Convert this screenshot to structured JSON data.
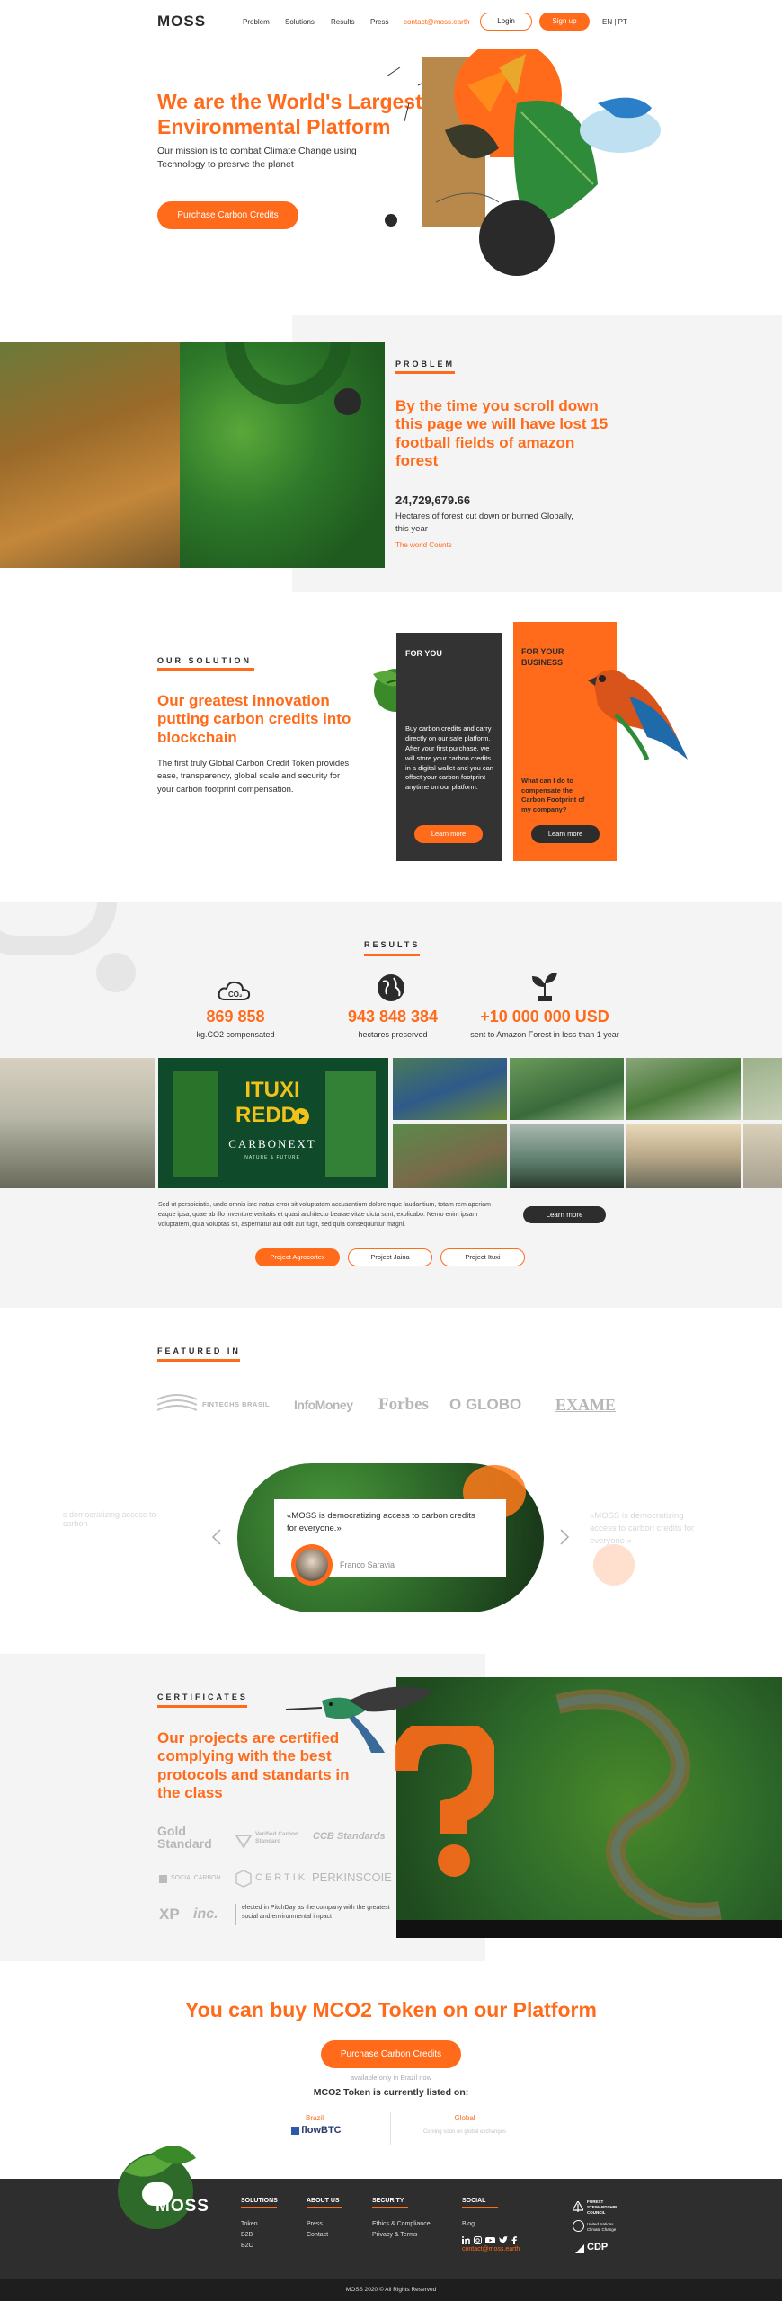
{
  "nav": {
    "logo": "MOSS",
    "links": [
      "Problem",
      "Solutions",
      "Results",
      "Press"
    ],
    "contact": "contact@moss.earth",
    "login": "Login",
    "signup": "Sign up",
    "lang": "EN | PT"
  },
  "hero": {
    "title": "We are the World's Largest Environmental Platform",
    "subtitle": "Our mission is to combat Climate Change using Technology to presrve the planet",
    "cta": "Purchase Carbon Credits"
  },
  "problem": {
    "label": "PROBLEM",
    "title": "By the time you scroll down this page we will have lost 15 football fields of amazon forest",
    "counter": "24,729,679.66",
    "counter_caption": "Hectares of forest cut down or burned Globally, this year",
    "source": "The world Counts"
  },
  "solution": {
    "label": "OUR SOLUTION",
    "title": "Our greatest innovation putting carbon credits into blockchain",
    "body": "The first truly Global Carbon Credit Token provides ease, transparency, global scale and security for your carbon footprint compensation.",
    "card_you": {
      "title": "FOR YOU",
      "body": "Buy carbon credits and carry directly on our safe platform. After your first purchase, we will store your carbon credits in a digital wallet and you can offset your carbon footprint anytime on our platform.",
      "button": "Learn more"
    },
    "card_business": {
      "title": "FOR YOUR BUSINESS",
      "body": "What can I do to compensate the Carbon Footprint of my company?",
      "button": "Learn more"
    }
  },
  "results": {
    "label": "RESULTS",
    "stats": [
      {
        "icon": "co2-cloud-icon",
        "value": "869 858",
        "caption": "kg.CO2 compensated"
      },
      {
        "icon": "globe-icon",
        "value": "943 848 384",
        "caption": "hectares preserved"
      },
      {
        "icon": "plant-icon",
        "value": "+10 000 000 USD",
        "caption": "sent to Amazon Forest in less than 1 year"
      }
    ],
    "video": {
      "title_line1": "ITUXI",
      "title_line2": "REDD+",
      "brand": "CARBONEXT",
      "tagline": "NATURE & FUTURE"
    },
    "description": "Sed ut perspiciatis, unde omnis iste natus error sit voluptatem accusantium doloremque laudantium, totam rem aperiam eaque ipsa, quae ab illo inventore veritatis et quasi architecto beatae vitae dicta sunt, explicabo. Nemo enim ipsam voluptatem, quia voluptas sit, aspernatur aut odit aut fugit, sed quia consequuntur magni.",
    "learn_more": "Learn more",
    "projects": [
      "Project Agrocortex",
      "Project Jaina",
      "Project Ituxi"
    ]
  },
  "featured": {
    "label": "FEATURED IN",
    "logos": [
      "FINTECHS BRASIL",
      "InfoMoney",
      "Forbes",
      "O GLOBO",
      "EXAME"
    ],
    "quote": "«MOSS is democratizing access to carbon credits for everyone.»",
    "author": "Franco Saravia",
    "ghost_left": "s democratizing access to carbon",
    "ghost_right": "«MOSS is democratizing access to carbon credits for everyone.»"
  },
  "certificates": {
    "label": "CERTIFICATES",
    "title": "Our projects are certified complying with the best protocols and standarts in the class",
    "logos": [
      "Gold Standard",
      "Verified Carbon Standard",
      "CCB Standards",
      "SOCIALCARBON",
      "CERTIK",
      "PERKINSCOIE",
      "XP",
      "inc."
    ],
    "pitchday": "elected in PitchDay as the company with the greatest social and environmental impact"
  },
  "buy": {
    "title": "You can buy MCO2 Token on our Platform",
    "cta": "Purchase Carbon Credits",
    "note": "available only in Brazil now",
    "listed": "MCO2 Token is currently listed on:",
    "brazil_label": "Brazil",
    "brazil_exchange": "flowBTC",
    "global_label": "Global",
    "global_note": "Coming soon on global exchanges"
  },
  "footer": {
    "columns": [
      {
        "title": "SOLUTIONS",
        "items": [
          "Token",
          "B2B",
          "B2C"
        ]
      },
      {
        "title": "ABOUT US",
        "items": [
          "Press",
          "Contact"
        ]
      },
      {
        "title": "SECURITY",
        "items": [
          "Ethics & Compliance",
          "Privacy & Terms"
        ]
      },
      {
        "title": "SOCIAL",
        "items": [
          "Blog"
        ]
      }
    ],
    "contact": "contact@moss.earth",
    "partners": [
      "FOREST STEWARDSHIP COUNCIL",
      "United Nations Climate Change",
      "CDP"
    ],
    "copyright": "MOSS 2020 © All Rights Reserved"
  },
  "colors": {
    "accent": "#ff6b1a",
    "dark": "#2e2e2e",
    "band": "#f4f4f4"
  }
}
